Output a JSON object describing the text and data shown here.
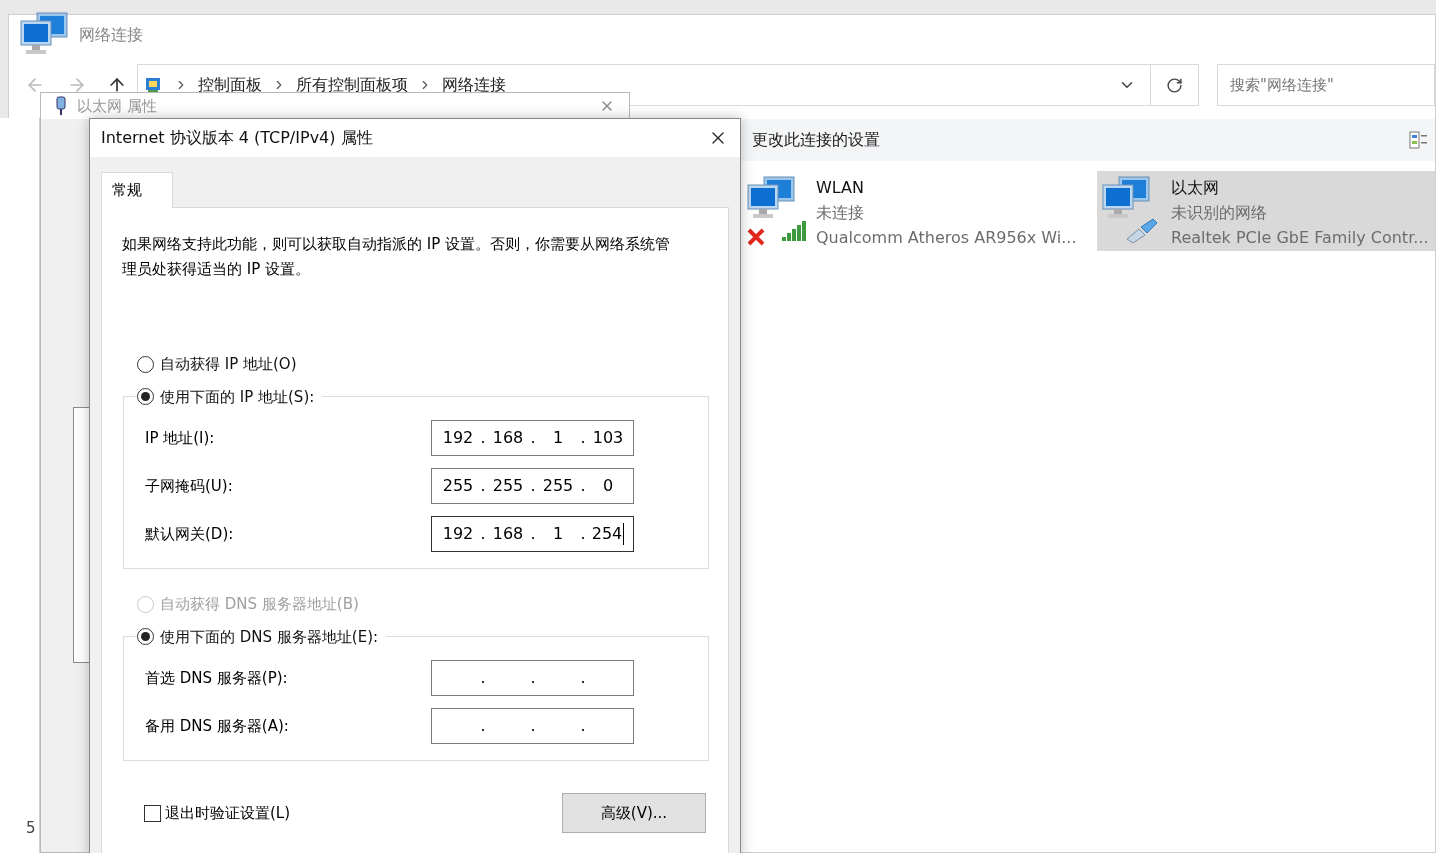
{
  "background_window": {
    "fragment": "5"
  },
  "explorer": {
    "title": "网络连接",
    "breadcrumb": [
      "控制面板",
      "所有控制面板项",
      "网络连接"
    ],
    "search": {
      "placeholder": "搜索\"网络连接\""
    },
    "command": "更改此连接的设置",
    "connections": [
      {
        "name": "WLAN",
        "status": "未连接",
        "device": "Qualcomm Atheros AR956x Wi...",
        "kind": "wireless",
        "disconnected": true,
        "selected": false
      },
      {
        "name": "以太网",
        "status": "未识别的网络",
        "device": "Realtek PCIe GbE Family Contr...",
        "kind": "wired",
        "disconnected": false,
        "selected": true
      }
    ]
  },
  "properties_window": {
    "title": "以太网 属性"
  },
  "dialog": {
    "title": "Internet 协议版本 4 (TCP/IPv4) 属性",
    "tabs": [
      {
        "label": "常规",
        "selected": true
      }
    ],
    "description": "如果网络支持此功能，则可以获取自动指派的 IP 设置。否则，你需要从网络系统管理员处获得适当的 IP 设置。",
    "separator": ".",
    "ip_mode": [
      {
        "label": "自动获得 IP 地址(O)",
        "selected": false,
        "disabled": false
      },
      {
        "label": "使用下面的 IP 地址(S):",
        "selected": true,
        "disabled": false
      }
    ],
    "ip_fields": [
      {
        "label": "IP 地址(I):",
        "octets": [
          "192",
          "168",
          "1",
          "103"
        ],
        "focused": false
      },
      {
        "label": "子网掩码(U):",
        "octets": [
          "255",
          "255",
          "255",
          "0"
        ],
        "focused": false
      },
      {
        "label": "默认网关(D):",
        "octets": [
          "192",
          "168",
          "1",
          "254"
        ],
        "focused": true
      }
    ],
    "dns_mode": [
      {
        "label": "自动获得 DNS 服务器地址(B)",
        "selected": false,
        "disabled": true
      },
      {
        "label": "使用下面的 DNS 服务器地址(E):",
        "selected": true,
        "disabled": false
      }
    ],
    "dns_fields": [
      {
        "label": "首选 DNS 服务器(P):",
        "focused": false
      },
      {
        "label": "备用 DNS 服务器(A):",
        "focused": false
      }
    ],
    "validate": {
      "label": "退出时验证设置(L)",
      "checked": false
    },
    "advanced_button": "高级(V)..."
  }
}
